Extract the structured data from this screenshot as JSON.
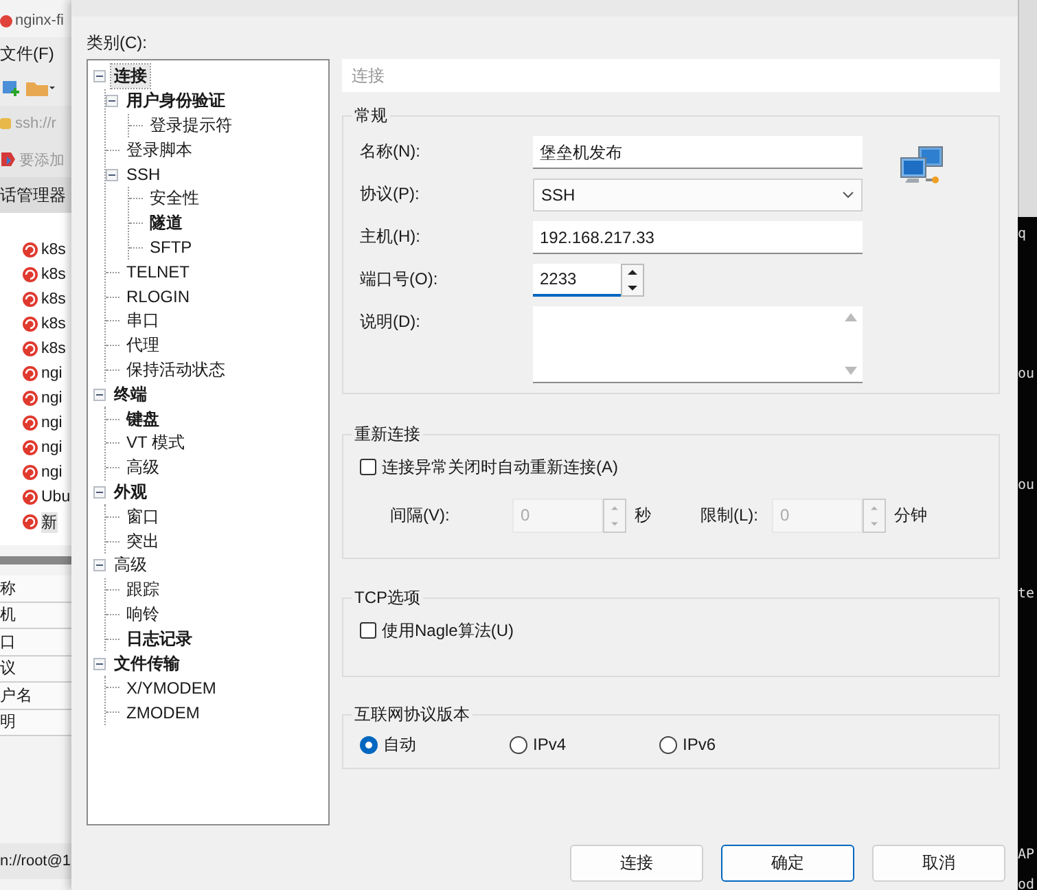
{
  "background_app": {
    "title": "nginx-fi",
    "menu": "文件(F)",
    "address": "ssh://r",
    "hint": "要添加",
    "panel_title": "话管理器",
    "sessions": [
      {
        "label": "k8s",
        "selected": false
      },
      {
        "label": "k8s",
        "selected": false
      },
      {
        "label": "k8s",
        "selected": false
      },
      {
        "label": "k8s",
        "selected": false
      },
      {
        "label": "k8s",
        "selected": false
      },
      {
        "label": "ngi",
        "selected": false
      },
      {
        "label": "ngi",
        "selected": false
      },
      {
        "label": "ngi",
        "selected": false
      },
      {
        "label": "ngi",
        "selected": false
      },
      {
        "label": "ngi",
        "selected": false
      },
      {
        "label": "Ubu",
        "selected": false
      },
      {
        "label": "新",
        "selected": true
      }
    ],
    "properties": [
      "称",
      "机",
      "口",
      "议",
      "户名",
      "明"
    ],
    "status": "n://root@1"
  },
  "dialog": {
    "category_label": "类别(C):",
    "tree": [
      {
        "label": "连接",
        "bold": true,
        "selected": true,
        "expanded": true,
        "children": [
          {
            "label": "用户身份验证",
            "bold": true,
            "selected": false,
            "expanded": true,
            "children": [
              {
                "label": "登录提示符",
                "bold": false,
                "selected": false
              }
            ]
          },
          {
            "label": "登录脚本",
            "bold": false,
            "selected": false
          },
          {
            "label": "SSH",
            "bold": false,
            "selected": false,
            "expanded": true,
            "children": [
              {
                "label": "安全性",
                "bold": false,
                "selected": false
              },
              {
                "label": "隧道",
                "bold": true,
                "selected": false
              },
              {
                "label": "SFTP",
                "bold": false,
                "selected": false
              }
            ]
          },
          {
            "label": "TELNET",
            "bold": false,
            "selected": false
          },
          {
            "label": "RLOGIN",
            "bold": false,
            "selected": false
          },
          {
            "label": "串口",
            "bold": false,
            "selected": false
          },
          {
            "label": "代理",
            "bold": false,
            "selected": false
          },
          {
            "label": "保持活动状态",
            "bold": false,
            "selected": false
          }
        ]
      },
      {
        "label": "终端",
        "bold": true,
        "selected": false,
        "expanded": true,
        "children": [
          {
            "label": "键盘",
            "bold": true,
            "selected": false
          },
          {
            "label": "VT 模式",
            "bold": false,
            "selected": false
          },
          {
            "label": "高级",
            "bold": false,
            "selected": false
          }
        ]
      },
      {
        "label": "外观",
        "bold": true,
        "selected": false,
        "expanded": true,
        "children": [
          {
            "label": "窗口",
            "bold": false,
            "selected": false
          },
          {
            "label": "突出",
            "bold": false,
            "selected": false
          }
        ]
      },
      {
        "label": "高级",
        "bold": false,
        "selected": false,
        "expanded": true,
        "children": [
          {
            "label": "跟踪",
            "bold": false,
            "selected": false
          },
          {
            "label": "响铃",
            "bold": false,
            "selected": false
          },
          {
            "label": "日志记录",
            "bold": true,
            "selected": false
          }
        ]
      },
      {
        "label": "文件传输",
        "bold": true,
        "selected": false,
        "expanded": true,
        "children": [
          {
            "label": "X/YMODEM",
            "bold": false,
            "selected": false
          },
          {
            "label": "ZMODEM",
            "bold": false,
            "selected": false
          }
        ]
      }
    ],
    "section_title": "连接",
    "general": {
      "title": "常规",
      "fields": [
        {
          "kind": "text",
          "label": "名称(N):",
          "value": "堡垒机发布"
        },
        {
          "kind": "select",
          "label": "协议(P):",
          "value": "SSH"
        },
        {
          "kind": "text",
          "label": "主机(H):",
          "value": "192.168.217.33"
        },
        {
          "kind": "spin",
          "label": "端口号(O):",
          "value": "2233",
          "focused": true
        },
        {
          "kind": "textarea",
          "label": "说明(D):"
        }
      ]
    },
    "reconnect": {
      "title": "重新连接",
      "checkbox": {
        "label": "连接异常关闭时自动重新连接(A)",
        "checked": false
      },
      "interval": {
        "label": "间隔(V):",
        "value": "0",
        "unit": "秒",
        "disabled": true
      },
      "limit": {
        "label": "限制(L):",
        "value": "0",
        "unit": "分钟",
        "disabled": true
      }
    },
    "tcp": {
      "title": "TCP选项",
      "checkbox": {
        "label": "使用Nagle算法(U)",
        "checked": false
      }
    },
    "ip_version": {
      "title": "互联网协议版本",
      "options": [
        {
          "label": "自动",
          "selected": true
        },
        {
          "label": "IPv4",
          "selected": false
        },
        {
          "label": "IPv6",
          "selected": false
        }
      ]
    },
    "buttons": [
      {
        "label": "连接",
        "default": false
      },
      {
        "label": "确定",
        "default": true
      },
      {
        "label": "取消",
        "default": false
      }
    ]
  },
  "terminal_strip": [
    "q",
    "ou",
    "ou",
    "te",
    "AP",
    "od"
  ]
}
